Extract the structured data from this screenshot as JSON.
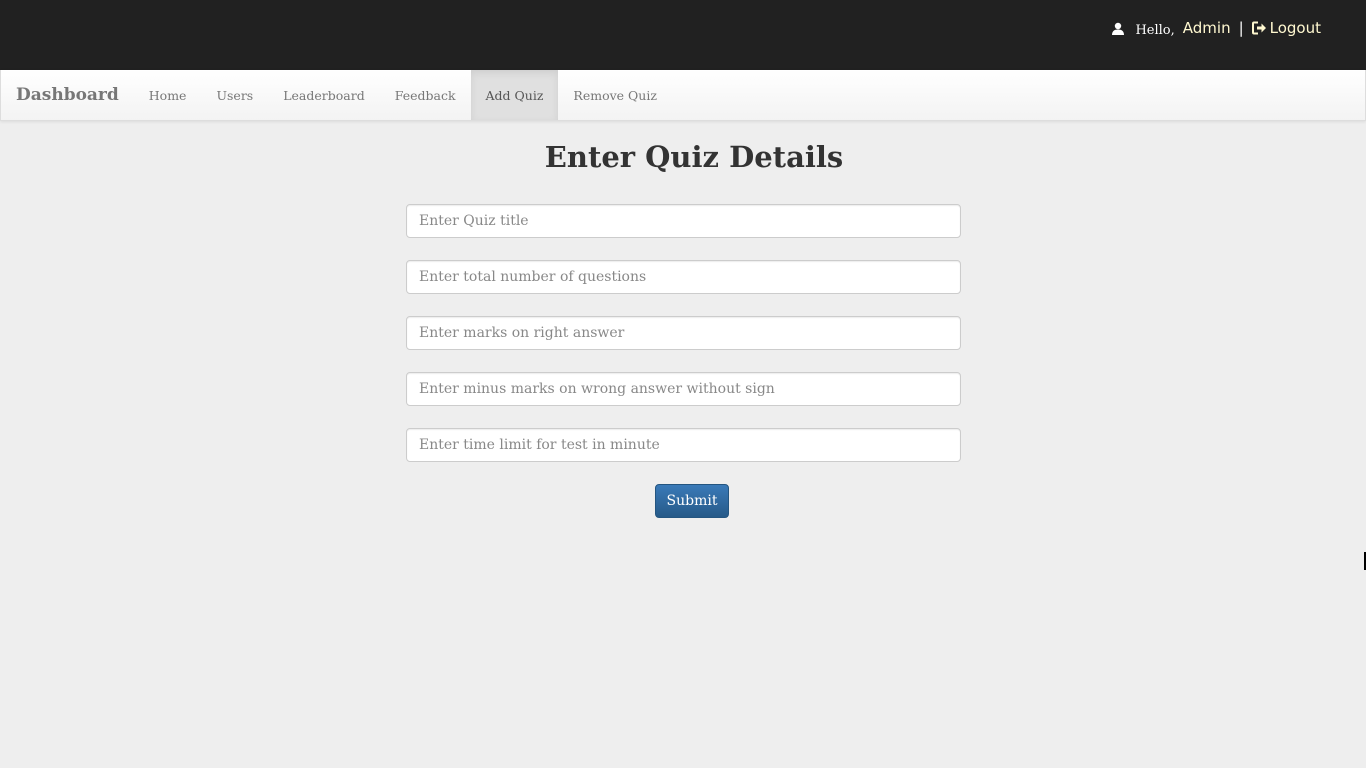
{
  "header": {
    "greeting": "Hello,",
    "username": "Admin",
    "separator": "|",
    "logout_label": "Logout",
    "icons": {
      "user": "user-icon",
      "logout": "sign-out-icon"
    }
  },
  "navbar": {
    "brand": "Dashboard",
    "items": [
      {
        "label": "Home",
        "active": false
      },
      {
        "label": "Users",
        "active": false
      },
      {
        "label": "Leaderboard",
        "active": false
      },
      {
        "label": "Feedback",
        "active": false
      },
      {
        "label": "Add Quiz",
        "active": true
      },
      {
        "label": "Remove Quiz",
        "active": false
      }
    ]
  },
  "main": {
    "title": "Enter Quiz Details",
    "fields": [
      {
        "placeholder": "Enter Quiz title",
        "value": ""
      },
      {
        "placeholder": "Enter total number of questions",
        "value": ""
      },
      {
        "placeholder": "Enter marks on right answer",
        "value": ""
      },
      {
        "placeholder": "Enter minus marks on wrong answer without sign",
        "value": ""
      },
      {
        "placeholder": "Enter time limit for test in minute",
        "value": ""
      }
    ],
    "submit_label": "Submit"
  },
  "colors": {
    "topbar": "#212121",
    "background": "#eeeeee",
    "button": "#2e6da4",
    "active_tab": "#e0e0e0"
  }
}
